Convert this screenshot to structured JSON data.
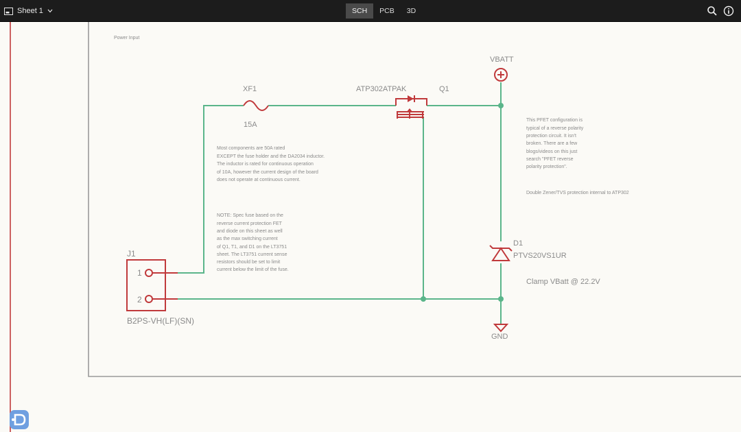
{
  "toolbar": {
    "sheet_label": "Sheet 1",
    "tabs": [
      {
        "label": "SCH",
        "active": true
      },
      {
        "label": "PCB",
        "active": false
      },
      {
        "label": "3D",
        "active": false
      }
    ],
    "icons": [
      "search-icon",
      "info-icon"
    ]
  },
  "schematic": {
    "section_title": "Power Input",
    "fuse": {
      "ref": "XF1",
      "value": "15A"
    },
    "mosfet": {
      "ref": "Q1",
      "part": "ATP302ATPAK"
    },
    "power_net": "VBATT",
    "ground_net": "GND",
    "diode": {
      "ref": "D1",
      "part": "PTVS20VS1UR",
      "note": "Clamp VBatt @ 22.2V"
    },
    "connector": {
      "ref": "J1",
      "part": "B2PS-VH(LF)(SN)",
      "pin1": "1",
      "pin2": "2"
    },
    "notes": {
      "rating": [
        "Most components are 50A rated",
        "EXCEPT the fuse holder and the DA2034 inductor.",
        "The inductor is rated for continuous operation",
        "of 10A, however the current design of the board",
        "does not operate at continuous current."
      ],
      "fuse_spec": [
        "NOTE: Spec fuse based on the",
        "reverse current protection FET",
        "and diode on this sheet as well",
        "as the max switching current",
        "of Q1, T1, and D1 on the LT3751",
        "sheet. The LT3751 current sense",
        "resistors should be set to limit",
        "current below the limit of the fuse."
      ],
      "pfet": [
        "This PFET configuration is",
        "typical of a reverse polarity",
        "protection circuit. It isn't",
        "broken. There are a few",
        "blogs/videos on this just",
        "search \"PFET reverse",
        "polarity protection\"."
      ],
      "zener": "Double Zener/TVS protection internal to ATP302"
    }
  },
  "colors": {
    "wire": "#5ab58a",
    "part": "#c0393b",
    "label": "#8a8a8a",
    "frame": "#9a9a9a",
    "toolbar": "#1c1c1c",
    "canvas": "#fbfaf6",
    "logo": "#6f9fe0"
  }
}
